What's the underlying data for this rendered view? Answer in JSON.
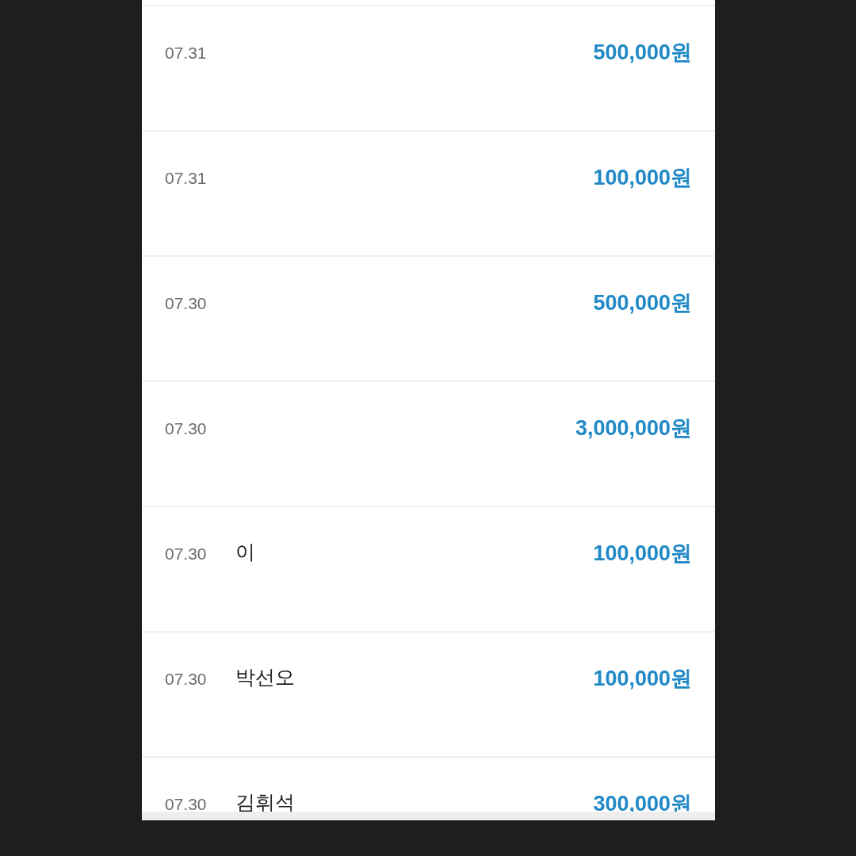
{
  "transactions": [
    {
      "date": "07.31",
      "amount": "500,000원"
    },
    {
      "date": "07.31",
      "amount": "100,000원"
    },
    {
      "date": "07.30",
      "amount": "500,000원"
    },
    {
      "date": "07.30",
      "amount": "3,000,000원"
    },
    {
      "date": "07.30",
      "name": "이",
      "amount": "100,000원"
    },
    {
      "date": "07.30",
      "name": "박선오",
      "amount": "100,000원"
    },
    {
      "date": "07.30",
      "name": "김휘석",
      "amount": "300,000원"
    }
  ]
}
